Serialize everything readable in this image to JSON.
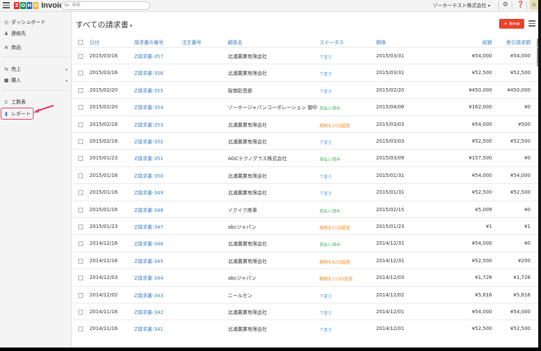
{
  "topbar": {
    "logo_letters": [
      "Z",
      "O",
      "H",
      "O"
    ],
    "logo_colors": [
      "#e42527",
      "#089949",
      "#226db4",
      "#f9b21d"
    ],
    "brand": "Invoice",
    "search_label": "Q",
    "search_placeholder": "検索",
    "org_name": "ゾーホーテスト株式会社"
  },
  "sidebar": {
    "items": [
      {
        "label": "ダッシュボード",
        "icon": "dashboard-icon",
        "glyph": "◎"
      },
      {
        "label": "連絡先",
        "icon": "user-icon",
        "glyph": "♟"
      },
      {
        "label": "商品",
        "icon": "item-icon",
        "glyph": "⊗"
      },
      {
        "label": "売上",
        "icon": "sales-icon",
        "glyph": "⇆"
      },
      {
        "label": "購入",
        "icon": "purchase-icon",
        "glyph": "■"
      },
      {
        "label": "工数表",
        "icon": "timesheet-icon",
        "glyph": "⊏"
      },
      {
        "label": "レポート",
        "icon": "report-icon",
        "glyph": "▮"
      }
    ],
    "highlight_color": "#e8336a"
  },
  "main": {
    "title": "すべての請求書",
    "new_button": "+ New",
    "columns": {
      "date": "日付",
      "invoice_no": "請求書の番号",
      "order_no": "注文番号",
      "customer": "顧客名",
      "status": "ステータス",
      "due": "期限",
      "total": "総額",
      "balance": "差引請求額"
    },
    "rows": [
      {
        "date": "2015/03/16",
        "inv": "Z請求書-357",
        "customer": "北浦農業有限会社",
        "status": "下書き",
        "status_color": "#6aa5d8",
        "due": "2015/03/31",
        "total": "¥54,000",
        "balance": "¥54,000"
      },
      {
        "date": "2015/03/16",
        "inv": "Z請求書-356",
        "customer": "北浦農業有限会社",
        "status": "下書き",
        "status_color": "#6aa5d8",
        "due": "2015/03/31",
        "total": "¥52,500",
        "balance": "¥52,500"
      },
      {
        "date": "2015/02/20",
        "inv": "Z請求書-355",
        "customer": "桜南駐音部",
        "status": "下書き",
        "status_color": "#6aa5d8",
        "due": "2015/02/20",
        "total": "¥450,000",
        "balance": "¥450,000"
      },
      {
        "date": "2015/02/20",
        "inv": "Z請求書-354",
        "customer": "ゾーホージャパンコーポレーション 御中",
        "status": "支払い済み",
        "status_color": "#36a84f",
        "due": "2015/04/06",
        "total": "¥162,000",
        "balance": "¥0"
      },
      {
        "date": "2015/02/16",
        "inv": "Z請求書-353",
        "customer": "北浦農業有限会社",
        "status": "期限を20日超過",
        "status_color": "#f08a24",
        "due": "2015/03/03",
        "total": "¥54,000",
        "balance": "¥500"
      },
      {
        "date": "2015/02/16",
        "inv": "Z請求書-352",
        "customer": "北浦農業有限会社",
        "status": "下書き",
        "status_color": "#6aa5d8",
        "due": "2015/03/03",
        "total": "¥52,500",
        "balance": "¥52,500"
      },
      {
        "date": "2015/01/23",
        "inv": "Z請求書-351",
        "customer": "AGCテクノグラス株式会社",
        "status": "支払い済み",
        "status_color": "#36a84f",
        "due": "2015/03/09",
        "total": "¥157,500",
        "balance": "¥0"
      },
      {
        "date": "2015/01/16",
        "inv": "Z請求書-350",
        "customer": "北浦農業有限会社",
        "status": "下書き",
        "status_color": "#6aa5d8",
        "due": "2015/01/31",
        "total": "¥54,000",
        "balance": "¥54,000"
      },
      {
        "date": "2015/01/16",
        "inv": "Z請求書-349",
        "customer": "北浦農業有限会社",
        "status": "下書き",
        "status_color": "#6aa5d8",
        "due": "2015/01/31",
        "total": "¥52,500",
        "balance": "¥52,500"
      },
      {
        "date": "2015/01/16",
        "inv": "Z請求書-348",
        "customer": "イクイク商事",
        "status": "支払い済み",
        "status_color": "#36a84f",
        "due": "2015/02/15",
        "total": "¥5,009",
        "balance": "¥0"
      },
      {
        "date": "2015/01/23",
        "inv": "Z請求書-347",
        "customer": "abcジャパン",
        "status": "期限を51日超過",
        "status_color": "#f08a24",
        "due": "2015/01/23",
        "total": "¥1",
        "balance": "¥1"
      },
      {
        "date": "2014/12/16",
        "inv": "Z請求書-346",
        "customer": "北浦農業有限会社",
        "status": "支払い済み",
        "status_color": "#36a84f",
        "due": "2014/12/31",
        "total": "¥54,000",
        "balance": "¥0"
      },
      {
        "date": "2014/12/16",
        "inv": "Z請求書-345",
        "customer": "北浦農業有限会社",
        "status": "期限を82日超過",
        "status_color": "#f08a24",
        "due": "2014/12/31",
        "total": "¥52,500",
        "balance": "¥200"
      },
      {
        "date": "2014/12/03",
        "inv": "Z請求書-344",
        "customer": "abcジャパン",
        "status": "期限を113日超過",
        "status_color": "#f08a24",
        "due": "2014/12/03",
        "total": "¥1,728",
        "balance": "¥1,728"
      },
      {
        "date": "2014/12/02",
        "inv": "Z請求書-343",
        "customer": "ニールセン",
        "status": "下書き",
        "status_color": "#6aa5d8",
        "due": "2014/12/02",
        "total": "¥5,616",
        "balance": "¥5,616"
      },
      {
        "date": "2014/11/16",
        "inv": "Z請求書-342",
        "customer": "北浦農業有限会社",
        "status": "下書き",
        "status_color": "#6aa5d8",
        "due": "2014/12/01",
        "total": "¥54,000",
        "balance": "¥54,000"
      },
      {
        "date": "2014/11/16",
        "inv": "Z請求書-341",
        "customer": "北浦農業有限会社",
        "status": "下書き",
        "status_color": "#6aa5d8",
        "due": "2014/12/01",
        "total": "¥52,500",
        "balance": "¥52,500"
      }
    ]
  }
}
